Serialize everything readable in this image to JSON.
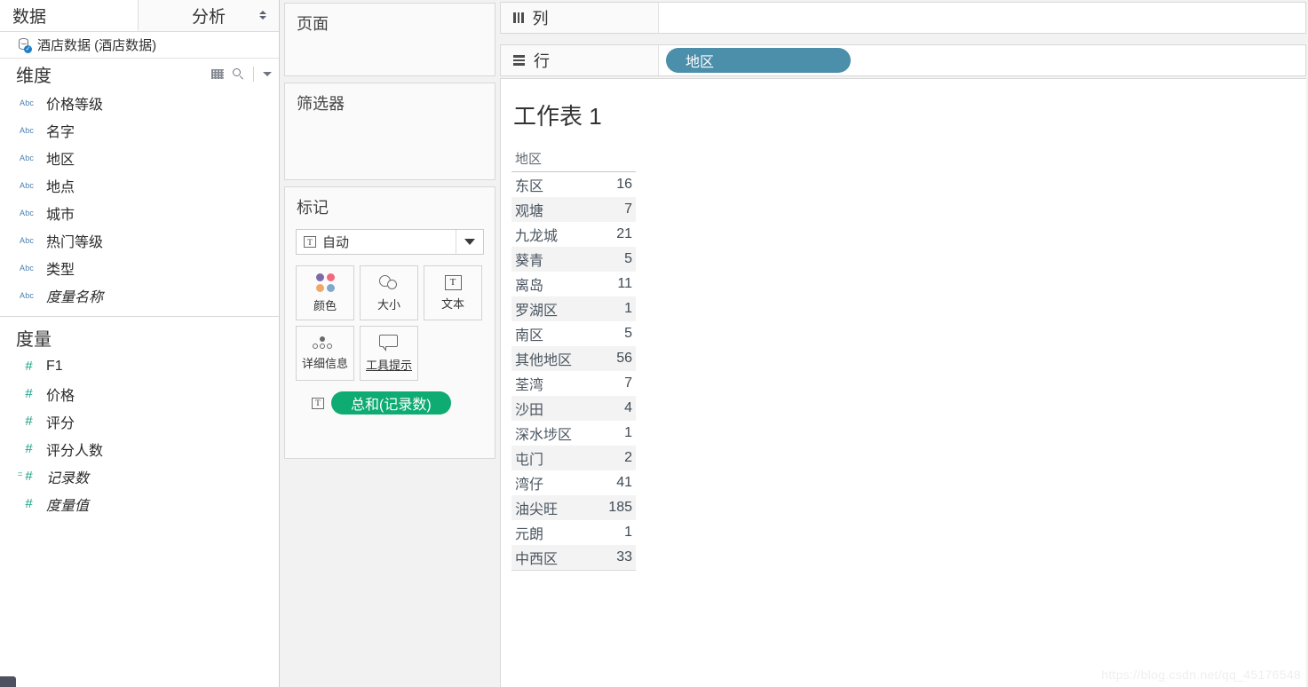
{
  "left_pane": {
    "tabs": [
      {
        "label": "数据",
        "name": "tab-data"
      },
      {
        "label": "分析",
        "name": "tab-analysis"
      }
    ],
    "datasource": {
      "label": "酒店数据 (酒店数据)",
      "icon": "database-connected-icon"
    },
    "dimensions": {
      "header": "维度",
      "tools": [
        "grid-view-icon",
        "search-icon",
        "chevron-down-icon"
      ],
      "items": [
        {
          "label": "价格等级",
          "type": "Abc",
          "italic": false
        },
        {
          "label": "名字",
          "type": "Abc",
          "italic": false
        },
        {
          "label": "地区",
          "type": "Abc",
          "italic": false
        },
        {
          "label": "地点",
          "type": "Abc",
          "italic": false
        },
        {
          "label": "城市",
          "type": "Abc",
          "italic": false
        },
        {
          "label": "热门等级",
          "type": "Abc",
          "italic": false
        },
        {
          "label": "类型",
          "type": "Abc",
          "italic": false
        },
        {
          "label": "度量名称",
          "type": "Abc",
          "italic": true
        }
      ]
    },
    "measures": {
      "header": "度量",
      "items": [
        {
          "label": "F1",
          "type": "#",
          "italic": false,
          "calc": false
        },
        {
          "label": "价格",
          "type": "#",
          "italic": false,
          "calc": false
        },
        {
          "label": "评分",
          "type": "#",
          "italic": false,
          "calc": false
        },
        {
          "label": "评分人数",
          "type": "#",
          "italic": false,
          "calc": false
        },
        {
          "label": "记录数",
          "type": "#",
          "italic": true,
          "calc": true
        },
        {
          "label": "度量值",
          "type": "#",
          "italic": true,
          "calc": false
        }
      ]
    }
  },
  "shelf_column": {
    "pages": {
      "title": "页面"
    },
    "filters": {
      "title": "筛选器"
    },
    "marks": {
      "title": "标记",
      "mark_type": {
        "value": "自动",
        "icon": "text-mark-icon"
      },
      "buttons": [
        {
          "label": "颜色",
          "icon": "color-palette-icon"
        },
        {
          "label": "大小",
          "icon": "size-circles-icon"
        },
        {
          "label": "文本",
          "icon": "text-box-icon"
        },
        {
          "label": "详细信息",
          "icon": "detail-dots-icon"
        },
        {
          "label": "工具提示",
          "icon": "tooltip-bubble-icon"
        }
      ],
      "pills": [
        {
          "label": "总和(记录数)",
          "color": "green",
          "icon": "text-mark-icon"
        }
      ]
    }
  },
  "shelves": {
    "columns": {
      "label": "列",
      "icon": "columns-icon",
      "pills": []
    },
    "rows": {
      "label": "行",
      "icon": "rows-icon",
      "pills": [
        {
          "label": "地区",
          "color": "blue"
        }
      ]
    }
  },
  "worksheet": {
    "title": "工作表 1",
    "watermark": "https://blog.csdn.net/qq_45176548"
  },
  "colors": {
    "pill_green": "#0eab72",
    "pill_blue": "#4b8fab",
    "dimension_icon": "#4a7fb0",
    "measure_icon": "#16a085",
    "panel_bg": "#f2f2f2"
  },
  "chart_data": {
    "type": "table",
    "title": "工作表 1",
    "columns": [
      "地区",
      "总和(记录数)"
    ],
    "categories": [
      "东区",
      "观塘",
      "九龙城",
      "葵青",
      "离岛",
      "罗湖区",
      "南区",
      "其他地区",
      "荃湾",
      "沙田",
      "深水埗区",
      "屯门",
      "湾仔",
      "油尖旺",
      "元朗",
      "中西区"
    ],
    "values": [
      16,
      7,
      21,
      5,
      11,
      1,
      5,
      56,
      7,
      4,
      1,
      2,
      41,
      185,
      1,
      33
    ],
    "xlabel": "地区",
    "ylabel": "总和(记录数)",
    "rows": [
      {
        "地区": "东区",
        "值": "16"
      },
      {
        "地区": "观塘",
        "值": "7"
      },
      {
        "地区": "九龙城",
        "值": "21"
      },
      {
        "地区": "葵青",
        "值": "5"
      },
      {
        "地区": "离岛",
        "值": "11"
      },
      {
        "地区": "罗湖区",
        "值": "1"
      },
      {
        "地区": "南区",
        "值": "5"
      },
      {
        "地区": "其他地区",
        "值": "56"
      },
      {
        "地区": "荃湾",
        "值": "7"
      },
      {
        "地区": "沙田",
        "值": "4"
      },
      {
        "地区": "深水埗区",
        "值": "1"
      },
      {
        "地区": "屯门",
        "值": "2"
      },
      {
        "地区": "湾仔",
        "值": "41"
      },
      {
        "地区": "油尖旺",
        "值": "185"
      },
      {
        "地区": "元朗",
        "值": "1"
      },
      {
        "地区": "中西区",
        "值": "33"
      }
    ]
  }
}
